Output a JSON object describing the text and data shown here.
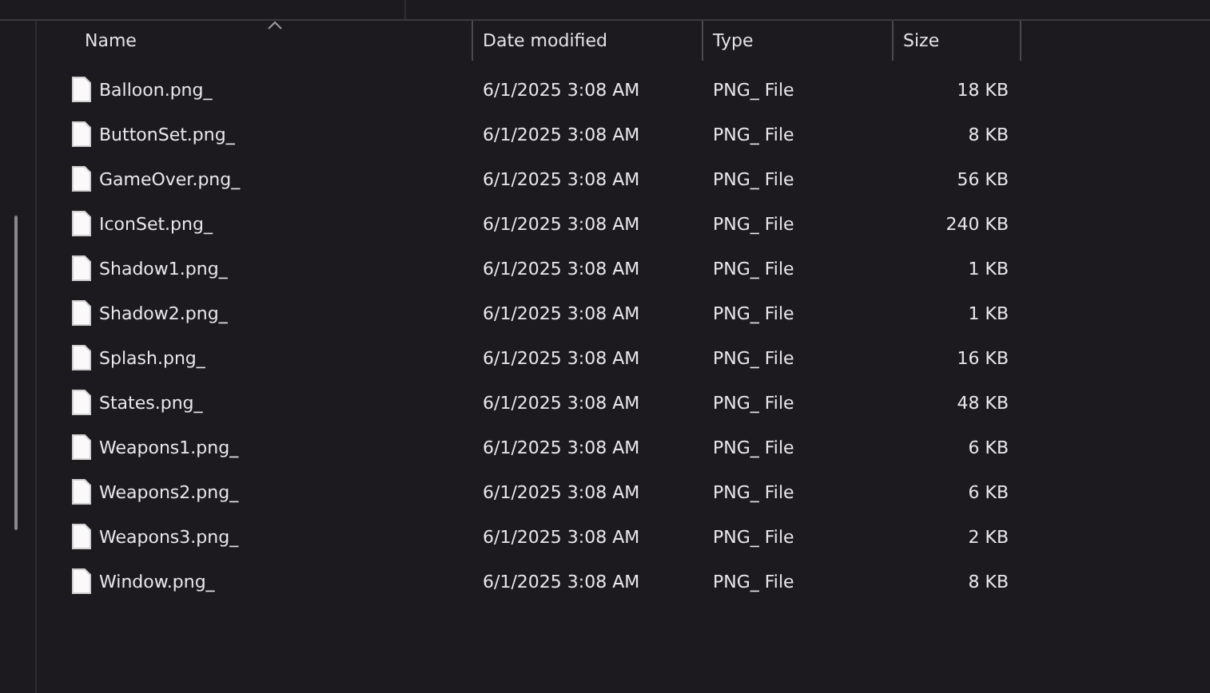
{
  "columns": [
    {
      "label": "Name",
      "sorted": true
    },
    {
      "label": "Date modified",
      "sorted": false
    },
    {
      "label": "Type",
      "sorted": false
    },
    {
      "label": "Size",
      "sorted": false
    }
  ],
  "files": [
    {
      "name": "Balloon.png_",
      "date": "6/1/2025 3:08 AM",
      "type": "PNG_ File",
      "size": "18 KB"
    },
    {
      "name": "ButtonSet.png_",
      "date": "6/1/2025 3:08 AM",
      "type": "PNG_ File",
      "size": "8 KB"
    },
    {
      "name": "GameOver.png_",
      "date": "6/1/2025 3:08 AM",
      "type": "PNG_ File",
      "size": "56 KB"
    },
    {
      "name": "IconSet.png_",
      "date": "6/1/2025 3:08 AM",
      "type": "PNG_ File",
      "size": "240 KB"
    },
    {
      "name": "Shadow1.png_",
      "date": "6/1/2025 3:08 AM",
      "type": "PNG_ File",
      "size": "1 KB"
    },
    {
      "name": "Shadow2.png_",
      "date": "6/1/2025 3:08 AM",
      "type": "PNG_ File",
      "size": "1 KB"
    },
    {
      "name": "Splash.png_",
      "date": "6/1/2025 3:08 AM",
      "type": "PNG_ File",
      "size": "16 KB"
    },
    {
      "name": "States.png_",
      "date": "6/1/2025 3:08 AM",
      "type": "PNG_ File",
      "size": "48 KB"
    },
    {
      "name": "Weapons1.png_",
      "date": "6/1/2025 3:08 AM",
      "type": "PNG_ File",
      "size": "6 KB"
    },
    {
      "name": "Weapons2.png_",
      "date": "6/1/2025 3:08 AM",
      "type": "PNG_ File",
      "size": "6 KB"
    },
    {
      "name": "Weapons3.png_",
      "date": "6/1/2025 3:08 AM",
      "type": "PNG_ File",
      "size": "2 KB"
    },
    {
      "name": "Window.png_",
      "date": "6/1/2025 3:08 AM",
      "type": "PNG_ File",
      "size": "8 KB"
    }
  ]
}
